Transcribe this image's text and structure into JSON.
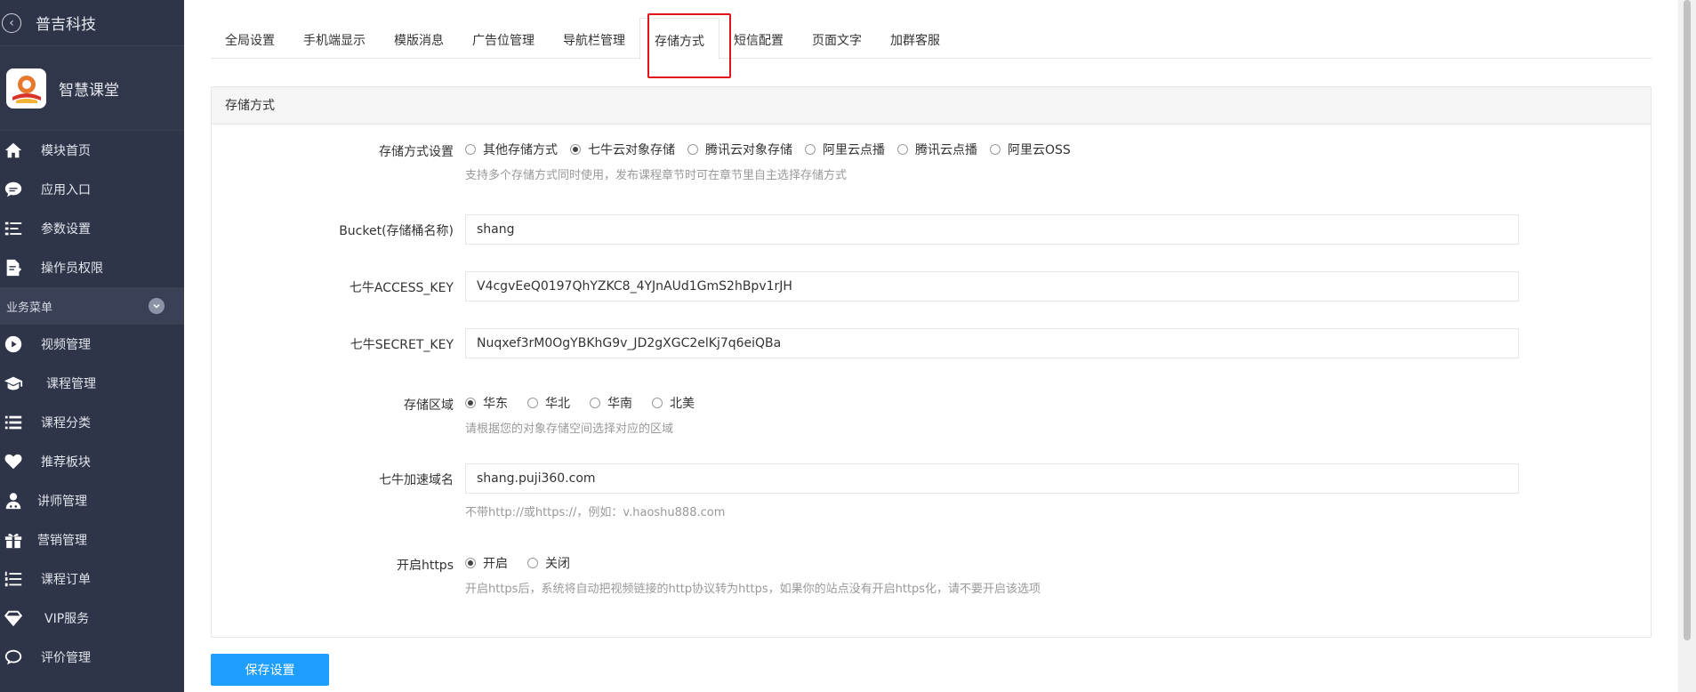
{
  "sidebar": {
    "org_name": "普吉科技",
    "app_name": "智慧课堂",
    "items_top": [
      {
        "label": "模块首页",
        "icon": "home-icon"
      },
      {
        "label": "应用入口",
        "icon": "chat-bubble-icon"
      },
      {
        "label": "参数设置",
        "icon": "list-settings-icon"
      },
      {
        "label": "操作员权限",
        "icon": "document-edit-icon"
      }
    ],
    "section_label": "业务菜单",
    "items_business": [
      {
        "label": "视频管理",
        "icon": "play-icon"
      },
      {
        "label": "课程管理",
        "icon": "graduation-cap-icon"
      },
      {
        "label": "课程分类",
        "icon": "list-icon"
      },
      {
        "label": "推荐板块",
        "icon": "heart-icon"
      },
      {
        "label": "讲师管理",
        "icon": "teacher-icon"
      },
      {
        "label": "营销管理",
        "icon": "gift-icon"
      },
      {
        "label": "课程订单",
        "icon": "ordered-list-icon"
      },
      {
        "label": "VIP服务",
        "icon": "diamond-icon"
      },
      {
        "label": "评价管理",
        "icon": "comment-icon"
      }
    ]
  },
  "tabs": [
    {
      "label": "全局设置"
    },
    {
      "label": "手机端显示"
    },
    {
      "label": "模版消息"
    },
    {
      "label": "广告位管理"
    },
    {
      "label": "导航栏管理"
    },
    {
      "label": "存储方式",
      "active": true
    },
    {
      "label": "短信配置"
    },
    {
      "label": "页面文字"
    },
    {
      "label": "加群客服"
    }
  ],
  "panel": {
    "title": "存储方式",
    "storage_method": {
      "label": "存储方式设置",
      "options": [
        {
          "label": "其他存储方式",
          "checked": false
        },
        {
          "label": "七牛云对象存储",
          "checked": true
        },
        {
          "label": "腾讯云对象存储",
          "checked": false
        },
        {
          "label": "阿里云点播",
          "checked": false
        },
        {
          "label": "腾讯云点播",
          "checked": false
        },
        {
          "label": "阿里云OSS",
          "checked": false
        }
      ],
      "help": "支持多个存储方式同时使用，发布课程章节时可在章节里自主选择存储方式"
    },
    "bucket": {
      "label": "Bucket(存储桶名称)",
      "value": "shang"
    },
    "access_key": {
      "label": "七牛ACCESS_KEY",
      "value": "V4cgvEeQ0197QhYZKC8_4YJnAUd1GmS2hBpv1rJH"
    },
    "secret_key": {
      "label": "七牛SECRET_KEY",
      "value": "Nuqxef3rM0OgYBKhG9v_JD2gXGC2elKj7q6eiQBa"
    },
    "region": {
      "label": "存储区域",
      "options": [
        {
          "label": "华东",
          "checked": true
        },
        {
          "label": "华北",
          "checked": false
        },
        {
          "label": "华南",
          "checked": false
        },
        {
          "label": "北美",
          "checked": false
        }
      ],
      "help": "请根据您的对象存储空间选择对应的区域"
    },
    "domain": {
      "label": "七牛加速域名",
      "value": "shang.puji360.com",
      "help": "不带http://或https://，例如：v.haoshu888.com"
    },
    "https": {
      "label": "开启https",
      "options": [
        {
          "label": "开启",
          "checked": true
        },
        {
          "label": "关闭",
          "checked": false
        }
      ],
      "help": "开启https后，系统将自动把视频链接的http协议转为https，如果你的站点没有开启https化，请不要开启该选项"
    }
  },
  "save_label": "保存设置",
  "colors": {
    "sidebar_bg": "#2f3549",
    "primary": "#1e9fff",
    "highlight": "#e0131a"
  }
}
